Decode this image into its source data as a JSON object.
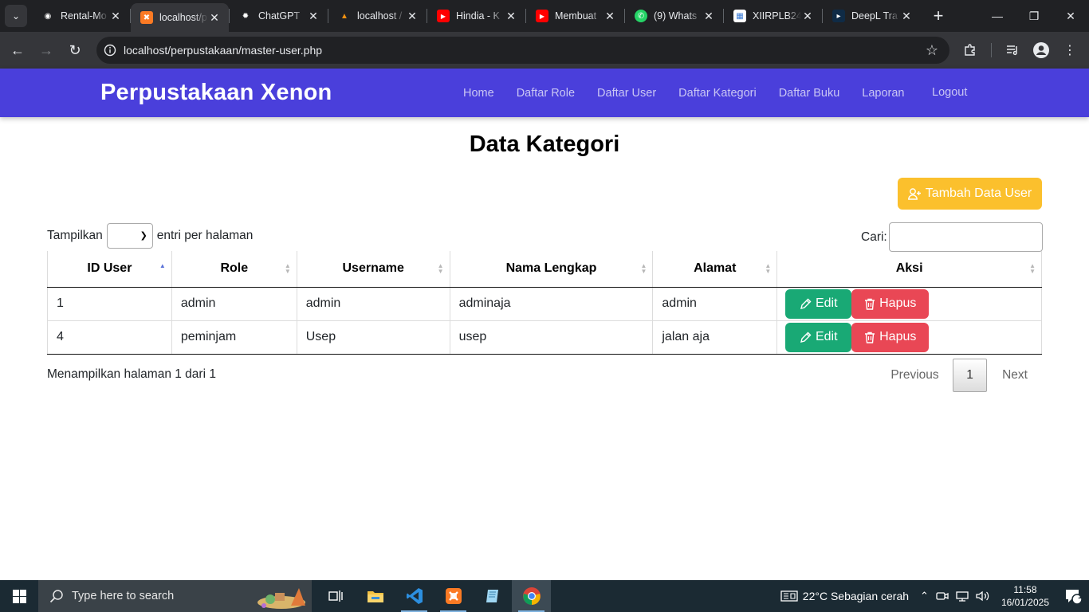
{
  "browser": {
    "tabs": [
      {
        "title": "Rental-Mo",
        "favicon": "github-icon",
        "color": "#ffffff"
      },
      {
        "title": "localhost/p",
        "favicon": "xampp-icon",
        "color": "#fb7a24",
        "active": true
      },
      {
        "title": "ChatGPT",
        "favicon": "chatgpt-icon",
        "color": "#ffffff"
      },
      {
        "title": "localhost /",
        "favicon": "phpmyadmin-icon",
        "color": "#f29111"
      },
      {
        "title": "Hindia - K",
        "favicon": "youtube-icon",
        "color": "#ff0000"
      },
      {
        "title": "Membuat",
        "favicon": "youtube-icon",
        "color": "#ff0000"
      },
      {
        "title": "(9) Whats",
        "favicon": "whatsapp-icon",
        "color": "#25d366"
      },
      {
        "title": "XIIRPLB24",
        "favicon": "classroom-icon",
        "color": "#ffffff"
      },
      {
        "title": "DeepL Tra",
        "favicon": "deepl-icon",
        "color": "#0f2b46"
      }
    ],
    "url_host": "localhost",
    "url_path": "/perpustakaan/master-user.php"
  },
  "navbar": {
    "brand": "Perpustakaan Xenon",
    "links": [
      "Home",
      "Daftar Role",
      "Daftar User",
      "Daftar Kategori",
      "Daftar Buku",
      "Laporan"
    ],
    "logout": "Logout",
    "bg_color": "#4a3fdb"
  },
  "main": {
    "title": "Data Kategori",
    "add_button": "Tambah Data User",
    "length_label_pre": "Tampilkan",
    "length_label_post": "entri per halaman",
    "search_label": "Cari:",
    "search_value": "",
    "columns": [
      "ID User",
      "Role",
      "Username",
      "Nama Lengkap",
      "Alamat",
      "Aksi"
    ],
    "rows": [
      {
        "id": "1",
        "role": "admin",
        "username": "admin",
        "nama": "adminaja",
        "alamat": "admin"
      },
      {
        "id": "4",
        "role": "peminjam",
        "username": "Usep",
        "nama": "usep",
        "alamat": "jalan aja"
      }
    ],
    "edit_label": "Edit",
    "delete_label": "Hapus",
    "info": "Menampilkan halaman 1 dari 1",
    "pagination": {
      "previous": "Previous",
      "current": "1",
      "next": "Next"
    },
    "colors": {
      "add": "#fbc02d",
      "edit": "#19a975",
      "delete": "#e94755"
    }
  },
  "taskbar": {
    "search_placeholder": "Type here to search",
    "weather": "22°C  Sebagian cerah",
    "time": "11:58",
    "date": "16/01/2025",
    "notifications": "1"
  }
}
